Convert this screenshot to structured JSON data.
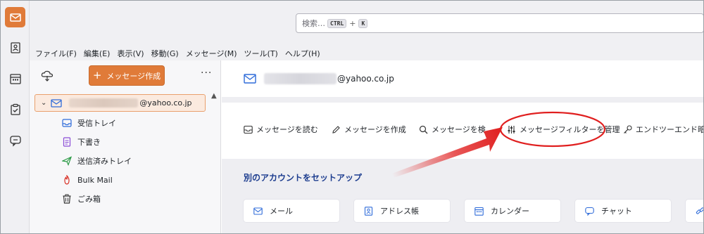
{
  "search": {
    "placeholder": "検索…",
    "shortcut_key1": "CTRL",
    "shortcut_plus": "+",
    "shortcut_key2": "K"
  },
  "menu": [
    "ファイル(F)",
    "編集(E)",
    "表示(V)",
    "移動(G)",
    "メッセージ(M)",
    "ツール(T)",
    "ヘルプ(H)"
  ],
  "folder_pane": {
    "write_label": "メッセージ作成",
    "write_plus": "+",
    "more_label": "···",
    "account_domain": "@yahoo.co.jp",
    "folders": [
      {
        "label": "受信トレイ",
        "icon": "inbox-icon"
      },
      {
        "label": "下書き",
        "icon": "drafts-icon"
      },
      {
        "label": "送信済みトレイ",
        "icon": "sent-icon"
      },
      {
        "label": "Bulk Mail",
        "icon": "junk-icon"
      },
      {
        "label": "ごみ箱",
        "icon": "trash-icon"
      }
    ]
  },
  "hub": {
    "account_domain": "@yahoo.co.jp",
    "actions": [
      "メッセージを読む",
      "メッセージを作成",
      "メッセージを検",
      "メッセージフィルターを管理",
      "エンドツーエンド暗号化"
    ],
    "setup_title": "別のアカウントをセットアップ",
    "cards": [
      "メール",
      "アドレス帳",
      "カレンダー",
      "チャット"
    ]
  },
  "colors": {
    "accent": "#e07b39",
    "link_blue": "#1d3d8f",
    "annotation_red": "#e01f1f"
  }
}
